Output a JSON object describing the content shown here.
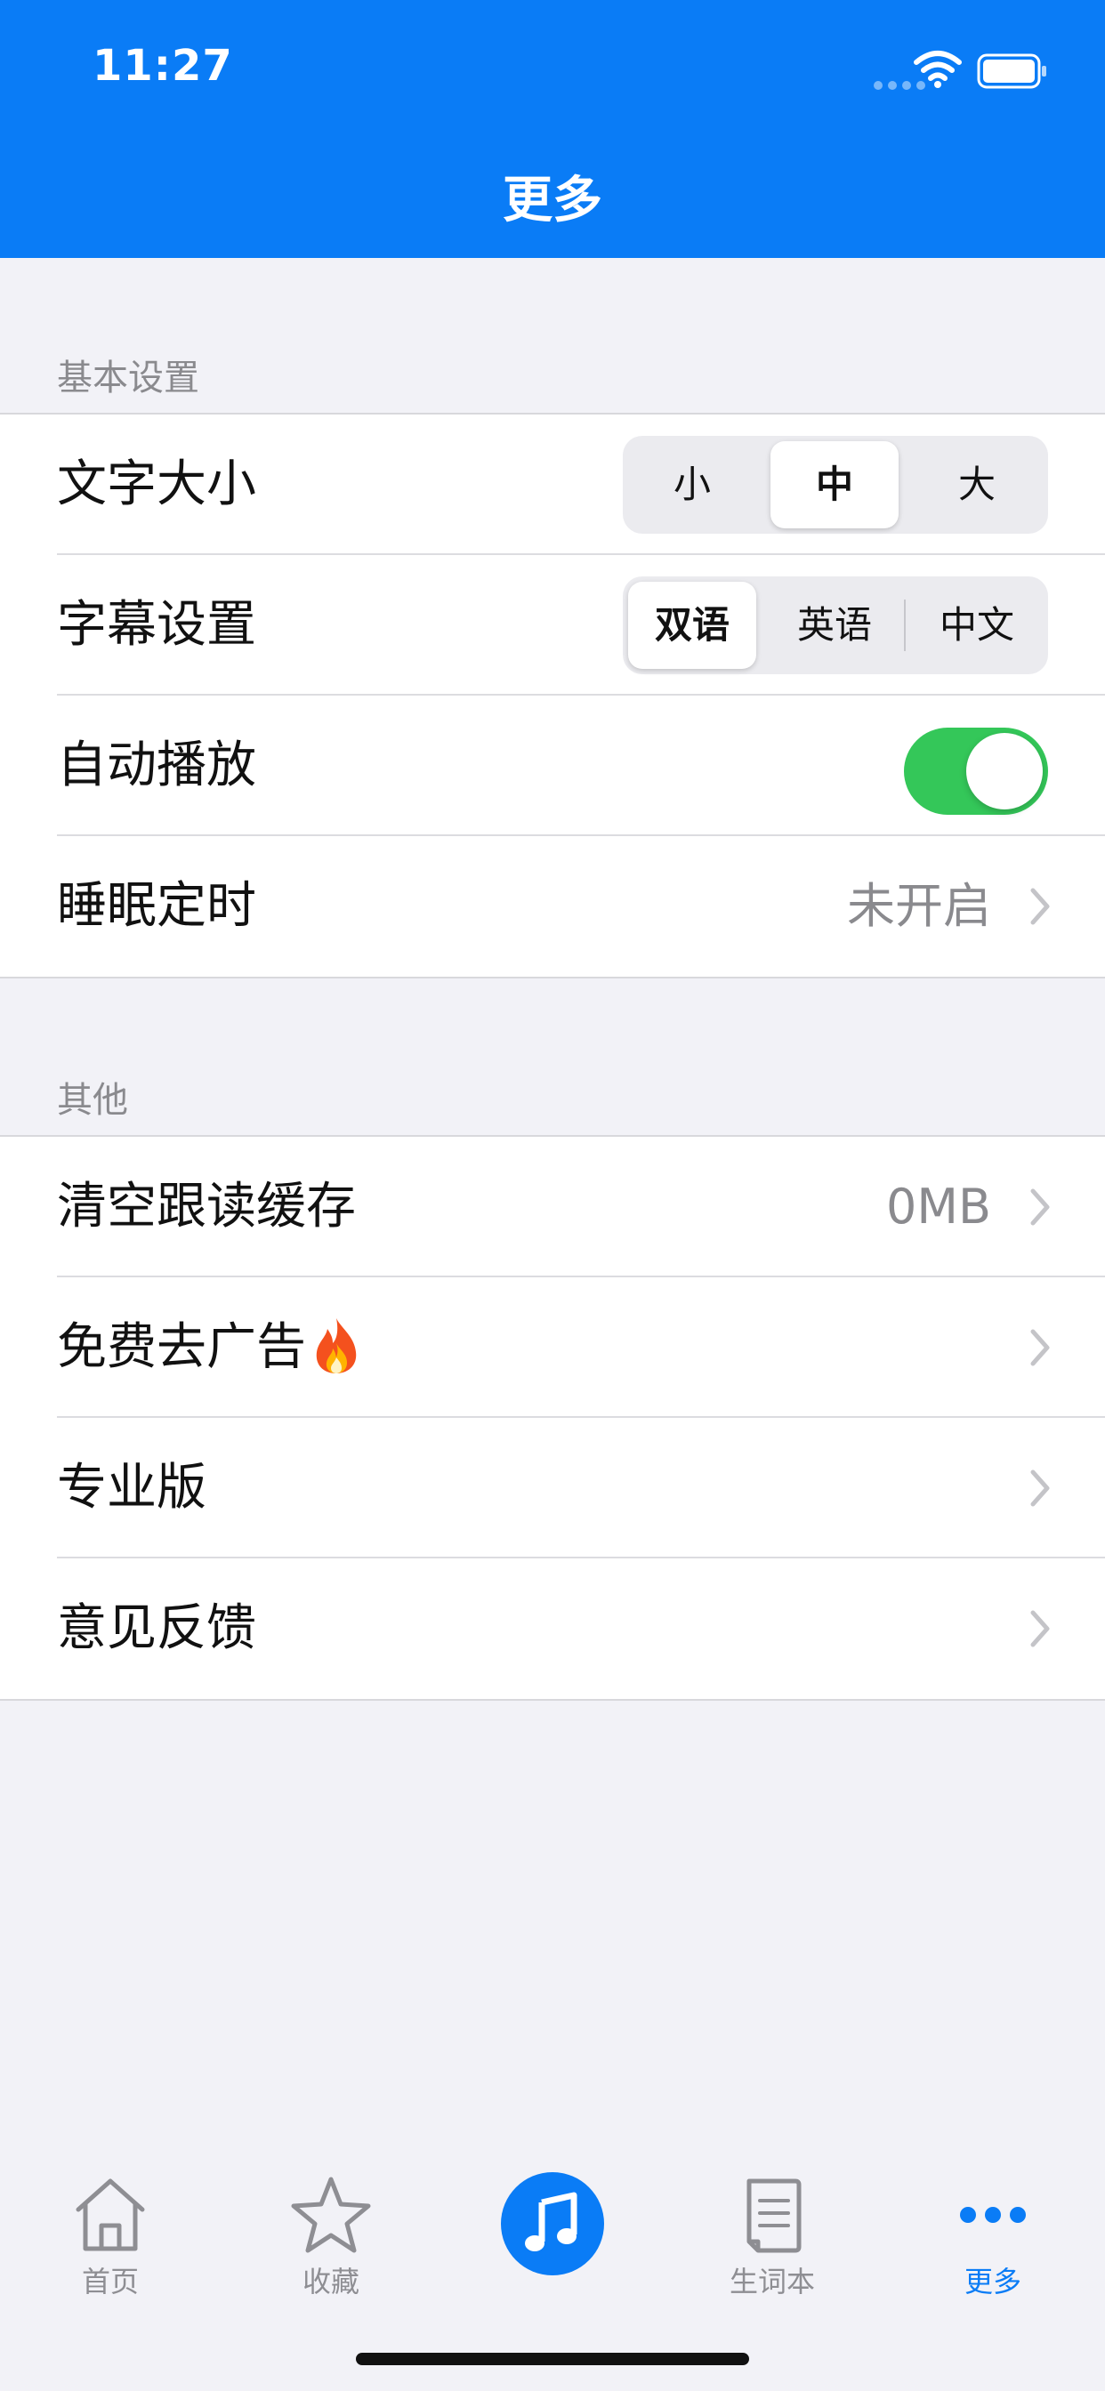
{
  "status_bar": {
    "time": "11:27"
  },
  "header": {
    "title": "更多"
  },
  "sections": [
    {
      "title": "基本设置"
    },
    {
      "title": "其他"
    }
  ],
  "basic": {
    "font_size": {
      "label": "文字大小",
      "options": [
        "小",
        "中",
        "大"
      ],
      "selected": "中"
    },
    "subtitle": {
      "label": "字幕设置",
      "options": [
        "双语",
        "英语",
        "中文"
      ],
      "selected": "双语"
    },
    "autoplay": {
      "label": "自动播放",
      "on": true
    },
    "sleep_timer": {
      "label": "睡眠定时",
      "value": "未开启"
    }
  },
  "other": {
    "clear_cache": {
      "label": "清空跟读缓存",
      "value": "0MB"
    },
    "remove_ads": {
      "label": "免费去广告"
    },
    "pro": {
      "label": "专业版"
    },
    "feedback": {
      "label": "意见反馈"
    }
  },
  "tabbar": {
    "items": [
      {
        "label": "首页",
        "icon": "home-icon"
      },
      {
        "label": "收藏",
        "icon": "star-icon"
      },
      {
        "label": "",
        "icon": "music-note-icon"
      },
      {
        "label": "生词本",
        "icon": "notebook-icon"
      },
      {
        "label": "更多",
        "icon": "more-dots-icon"
      }
    ],
    "active_index": 4
  },
  "colors": {
    "accent": "#0a7cf6",
    "toggle_on": "#34c759",
    "background": "#f2f2f7"
  }
}
